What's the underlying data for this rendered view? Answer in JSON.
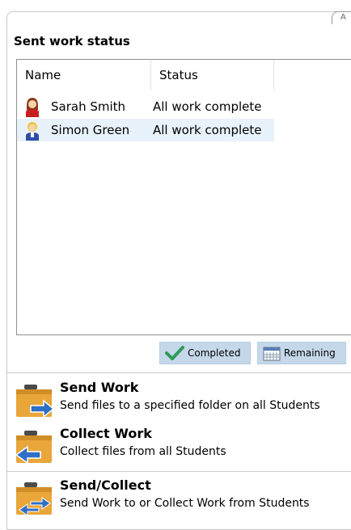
{
  "panel": {
    "title": "Sent work status",
    "tab_glyph": "A"
  },
  "list": {
    "columns": [
      "Name",
      "Status"
    ],
    "rows": [
      {
        "name": "Sarah Smith",
        "status": "All work complete",
        "avatar": "female-student-icon"
      },
      {
        "name": "Simon Green",
        "status": "All work complete",
        "avatar": "male-student-icon"
      }
    ]
  },
  "legend": {
    "completed": "Completed",
    "remaining": "Remaining"
  },
  "actions": [
    {
      "title": "Send Work",
      "desc": "Send files to a specified folder on all Students",
      "icon": "send-work-folder-icon"
    },
    {
      "title": "Collect Work",
      "desc": "Collect files from all Students",
      "icon": "collect-work-folder-icon"
    },
    {
      "title": "Send/Collect",
      "desc": "Send Work to or Collect Work from Students",
      "icon": "send-collect-folder-icon"
    }
  ],
  "colors": {
    "legend_bg": "#c5d8ea",
    "selected_row": "#e8f2fb",
    "folder": "#e9a63a",
    "arrow": "#2f6fc6"
  }
}
